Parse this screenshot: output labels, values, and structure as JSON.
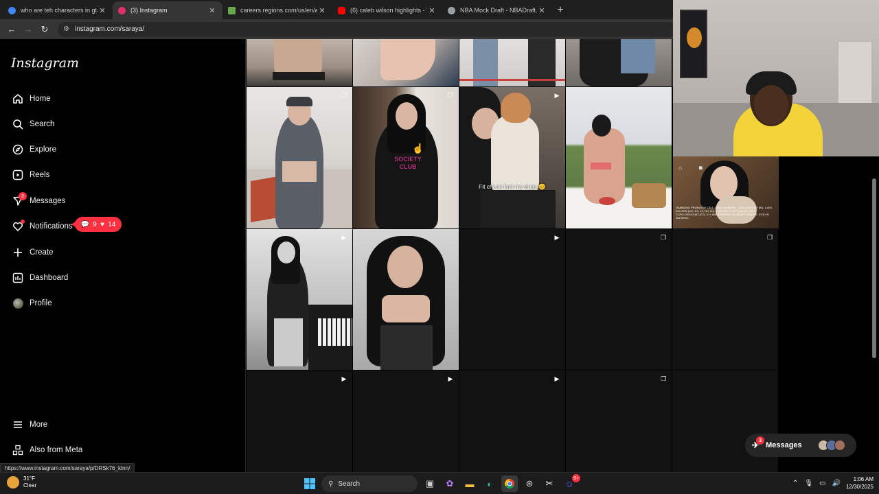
{
  "browser": {
    "tabs": [
      {
        "title": "who are teh characters in gta vi",
        "favicon_color": "#4285f4",
        "active": false
      },
      {
        "title": "(3) Instagram",
        "favicon_color": "#e1306c",
        "active": true
      },
      {
        "title": "careers.regions.com/us/en/app",
        "favicon_color": "#6aa84f",
        "active": false
      },
      {
        "title": "(6) caleb wilson highlights - You",
        "favicon_color": "#ff0000",
        "active": false
      },
      {
        "title": "NBA Mock Draft - NBADraft.net",
        "favicon_color": "#9aa0a6",
        "active": false
      }
    ],
    "new_tab_label": "+",
    "url": "instagram.com/saraya/",
    "status_link": "https://www.instagram.com/saraya/p/DRSk76_ktnn/"
  },
  "sidebar": {
    "logo": "Instagram",
    "items": [
      {
        "label": "Home",
        "icon": "home-icon",
        "glyph": "⌂"
      },
      {
        "label": "Search",
        "icon": "search-icon",
        "glyph": "⚲"
      },
      {
        "label": "Explore",
        "icon": "compass-icon",
        "glyph": "◎"
      },
      {
        "label": "Reels",
        "icon": "reels-icon",
        "glyph": "▷"
      },
      {
        "label": "Messages",
        "icon": "messenger-icon",
        "glyph": "✈",
        "badge": "3"
      },
      {
        "label": "Notifications",
        "icon": "heart-icon",
        "glyph": "♡"
      },
      {
        "label": "Create",
        "icon": "plus-icon",
        "glyph": "+"
      },
      {
        "label": "Dashboard",
        "icon": "chart-icon",
        "glyph": "▤"
      },
      {
        "label": "Profile",
        "icon": "avatar-icon",
        "glyph": ""
      }
    ],
    "notif_pill": {
      "comments": "9",
      "likes": "14"
    },
    "more": "More",
    "also_from_meta": "Also from Meta"
  },
  "grid": {
    "caption": "Fit check feat my dogs 😊"
  },
  "pip_caption": "GAMBLING PROBLEM? CALL 1-800-GAMBLER, 1-800-9-WITH-IT (IN), 1-800-522-4700 (CO, KS, KY, NH, NJ), 1-800-BETS-OFF (IA) OR VISIT CCPG.ORG/CHAT (CT). 21+ AND PRESENT IN SELECT STATES. VOID IN ONTARIO.",
  "messages_dock": {
    "label": "Messages",
    "badge": "3"
  },
  "taskbar": {
    "weather_temp": "31°F",
    "weather_desc": "Clear",
    "search_label": "Search",
    "time": "1:06 AM",
    "date": "12/30/2025",
    "discord_badge": "9+"
  }
}
